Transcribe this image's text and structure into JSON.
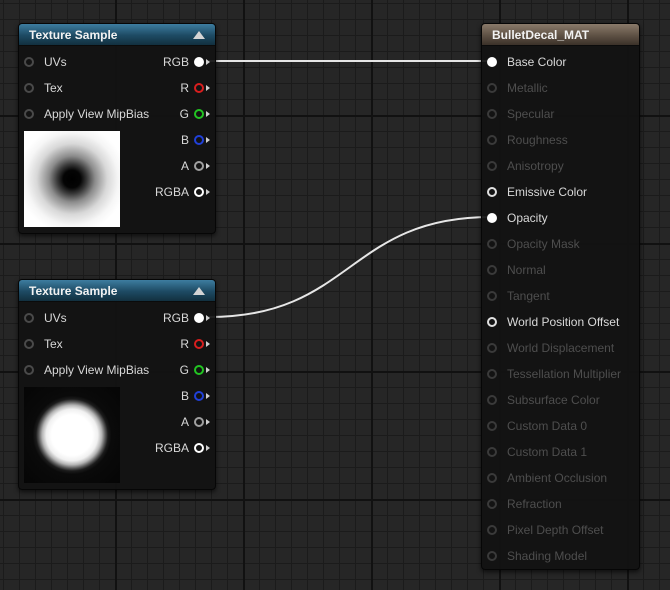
{
  "texture_sample_1": {
    "title": "Texture Sample",
    "inputs": [
      "UVs",
      "Tex",
      "Apply View MipBias"
    ],
    "outputs": [
      {
        "label": "RGB",
        "color": "#ffffff",
        "connected": true
      },
      {
        "label": "R",
        "color": "#d81e1e",
        "connected": false
      },
      {
        "label": "G",
        "color": "#22c422",
        "connected": false
      },
      {
        "label": "B",
        "color": "#2040d8",
        "connected": false
      },
      {
        "label": "A",
        "color": "#a0a0a0",
        "connected": false
      },
      {
        "label": "RGBA",
        "color": "#ffffff",
        "connected": false
      }
    ],
    "preview": "dark-ring-texture"
  },
  "texture_sample_2": {
    "title": "Texture Sample",
    "inputs": [
      "UVs",
      "Tex",
      "Apply View MipBias"
    ],
    "outputs": [
      {
        "label": "RGB",
        "color": "#ffffff",
        "connected": true
      },
      {
        "label": "R",
        "color": "#d81e1e",
        "connected": false
      },
      {
        "label": "G",
        "color": "#22c422",
        "connected": false
      },
      {
        "label": "B",
        "color": "#2040d8",
        "connected": false
      },
      {
        "label": "A",
        "color": "#a0a0a0",
        "connected": false
      },
      {
        "label": "RGBA",
        "color": "#ffffff",
        "connected": false
      }
    ],
    "preview": "soft-white-circle-texture"
  },
  "material": {
    "title": "BulletDecal_MAT",
    "inputs": [
      {
        "label": "Base Color",
        "state": "connected"
      },
      {
        "label": "Metallic",
        "state": "disabled"
      },
      {
        "label": "Specular",
        "state": "disabled"
      },
      {
        "label": "Roughness",
        "state": "disabled"
      },
      {
        "label": "Anisotropy",
        "state": "disabled"
      },
      {
        "label": "Emissive Color",
        "state": "enabled"
      },
      {
        "label": "Opacity",
        "state": "connected"
      },
      {
        "label": "Opacity Mask",
        "state": "disabled"
      },
      {
        "label": "Normal",
        "state": "disabled"
      },
      {
        "label": "Tangent",
        "state": "disabled"
      },
      {
        "label": "World Position Offset",
        "state": "enabled"
      },
      {
        "label": "World Displacement",
        "state": "disabled"
      },
      {
        "label": "Tessellation Multiplier",
        "state": "disabled"
      },
      {
        "label": "Subsurface Color",
        "state": "disabled"
      },
      {
        "label": "Custom Data 0",
        "state": "disabled"
      },
      {
        "label": "Custom Data 1",
        "state": "disabled"
      },
      {
        "label": "Ambient Occlusion",
        "state": "disabled"
      },
      {
        "label": "Refraction",
        "state": "disabled"
      },
      {
        "label": "Pixel Depth Offset",
        "state": "disabled"
      },
      {
        "label": "Shading Model",
        "state": "disabled"
      }
    ]
  },
  "colors": {
    "wire": "#e6e6e6",
    "texture_header": "#1d4a63",
    "material_header": "#5e5144",
    "graph_background": "#262626"
  }
}
